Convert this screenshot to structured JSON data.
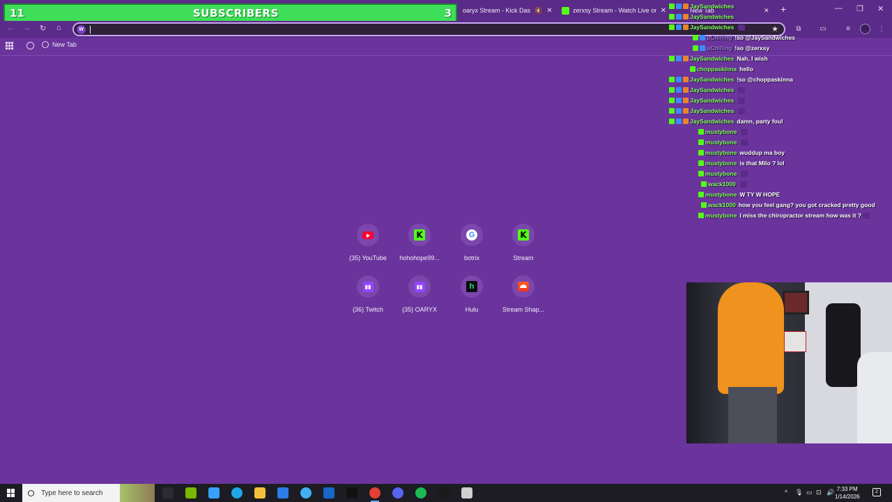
{
  "colors": {
    "accent": "#6a349c",
    "overlay_green": "#3fde58",
    "chat_name": "#7dff57"
  },
  "subscriber_overlay": {
    "left_count": "11",
    "title": "SUBSCRIBERS",
    "right_count": "3"
  },
  "tabs": [
    {
      "title": "oaryx Stream - Kick Dashbo",
      "icon": "kick-icon",
      "extra": "🔇"
    },
    {
      "title": "zerxsy Stream - Watch Live on",
      "icon": "kick-icon"
    },
    {
      "title": "New Tab",
      "icon": "none"
    }
  ],
  "window_controls": {
    "new_tab": "+",
    "minimize": "—",
    "restore": "❐",
    "close": "✕"
  },
  "navigation": {
    "back": "←",
    "forward": "→",
    "reload": "↻",
    "home": "⌂",
    "omnibox_value": "",
    "bookmark_star": "★"
  },
  "bookmarks_bar": {
    "items": [
      {
        "label": "New Tab"
      }
    ]
  },
  "shortcuts": [
    {
      "label": "(35) YouTube",
      "icon": "youtube-icon"
    },
    {
      "label": "hohohope99...",
      "icon": "kick-icon"
    },
    {
      "label": "botrix",
      "icon": "google-icon"
    },
    {
      "label": "Stream",
      "icon": "kick-icon"
    },
    {
      "label": "(36) Twitch",
      "icon": "twitch-icon"
    },
    {
      "label": "(35) OARYX",
      "icon": "twitch-icon"
    },
    {
      "label": "Hulu",
      "icon": "hulu-icon"
    },
    {
      "label": "Stream Shap...",
      "icon": "soundcloud-icon"
    }
  ],
  "chat": [
    {
      "user": "JaySandwiches",
      "msg": ""
    },
    {
      "user": "JaySandwiches",
      "msg": ""
    },
    {
      "user": "JaySandwiches",
      "msg": ""
    },
    {
      "user": "uChilling",
      "msg": "!so @JaySandwiches"
    },
    {
      "user": "uChilling",
      "msg": "!so @zerxsy"
    },
    {
      "user": "JaySandwiches",
      "msg": "Nah, I wish"
    },
    {
      "user": "choppaskinna",
      "msg": "hello"
    },
    {
      "user": "JaySandwiches",
      "msg": "!so @choppaskinna"
    },
    {
      "user": "JaySandwiches",
      "msg": ""
    },
    {
      "user": "JaySandwiches",
      "msg": ""
    },
    {
      "user": "JaySandwiches",
      "msg": ""
    },
    {
      "user": "JaySandwiches",
      "msg": "damn, party foul"
    },
    {
      "user": "mustybone",
      "msg": ""
    },
    {
      "user": "mustybone",
      "msg": ""
    },
    {
      "user": "mustybone",
      "msg": "wuddup ma boy"
    },
    {
      "user": "mustybone",
      "msg": "is that Milo ? lol"
    },
    {
      "user": "mustybone",
      "msg": ""
    },
    {
      "user": "wack1000",
      "msg": ""
    },
    {
      "user": "mustybone",
      "msg": "W TY W HOPE"
    },
    {
      "user": "wack1000",
      "msg": "how you feel gang? you got cracked pretty good"
    },
    {
      "user": "mustybone",
      "msg": "I miss the chiropractor stream how was it ?"
    }
  ],
  "taskbar": {
    "search_placeholder": "Type here to search",
    "time": "7:33 PM",
    "date": "1/14/2026",
    "notifications": "2",
    "apps": [
      {
        "icon": "task-view-icon",
        "color": "#2b2b33"
      },
      {
        "icon": "nvidia-icon",
        "color": "#76b900"
      },
      {
        "icon": "copilot-icon",
        "color": "#3aa0ff"
      },
      {
        "icon": "edge-icon",
        "color": "#1fa7e8"
      },
      {
        "icon": "file-explorer-icon",
        "color": "#f3c03c"
      },
      {
        "icon": "store-icon",
        "color": "#2d7de8"
      },
      {
        "icon": "photos-icon",
        "color": "#3fb0f0"
      },
      {
        "icon": "outlook-icon",
        "color": "#1867c8"
      },
      {
        "icon": "tiktok-icon",
        "color": "#111111"
      },
      {
        "icon": "chrome-icon",
        "color": "#e34133"
      },
      {
        "icon": "discord-icon",
        "color": "#5865f2"
      },
      {
        "icon": "spotify-icon",
        "color": "#1db954"
      },
      {
        "icon": "obs-icon",
        "color": "#1a1a1a"
      },
      {
        "icon": "settings-icon",
        "color": "#cfcfcf"
      }
    ]
  }
}
